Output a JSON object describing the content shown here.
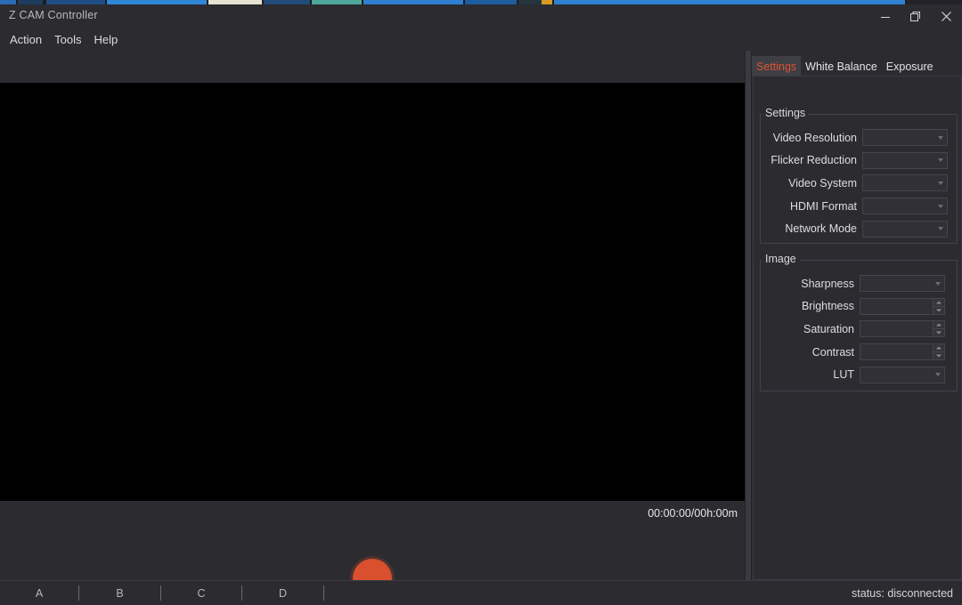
{
  "window": {
    "title": "Z CAM Controller",
    "controls": {
      "minimize": "minimize-icon",
      "maximize": "restore-icon",
      "close": "close-icon"
    }
  },
  "menu": {
    "items": [
      {
        "label": "Action"
      },
      {
        "label": "Tools"
      },
      {
        "label": "Help"
      }
    ]
  },
  "preview": {
    "timecode": "00:00:00/00h:00m",
    "record_button": "record-button",
    "background_color": "#000000"
  },
  "panel": {
    "tabs": [
      {
        "label": "Settings",
        "active": true
      },
      {
        "label": "White Balance",
        "active": false
      },
      {
        "label": "Exposure",
        "active": false
      }
    ],
    "groups": [
      {
        "title": "Settings",
        "fields": [
          {
            "label": "Video Resolution",
            "value": "",
            "control": "combobox"
          },
          {
            "label": "Flicker Reduction",
            "value": "",
            "control": "combobox"
          },
          {
            "label": "Video System",
            "value": "",
            "control": "combobox"
          },
          {
            "label": "HDMI Format",
            "value": "",
            "control": "combobox"
          },
          {
            "label": "Network Mode",
            "value": "",
            "control": "combobox"
          }
        ]
      },
      {
        "title": "Image",
        "fields": [
          {
            "label": "Sharpness",
            "value": "",
            "control": "combobox"
          },
          {
            "label": "Brightness",
            "value": "",
            "control": "spinbox"
          },
          {
            "label": "Saturation",
            "value": "",
            "control": "spinbox"
          },
          {
            "label": "Contrast",
            "value": "",
            "control": "spinbox"
          },
          {
            "label": "LUT",
            "value": "",
            "control": "combobox"
          }
        ]
      }
    ]
  },
  "status_bar": {
    "cells": [
      {
        "label": "A"
      },
      {
        "label": "B"
      },
      {
        "label": "C"
      },
      {
        "label": "D"
      }
    ],
    "status": "status: disconnected"
  },
  "colors": {
    "window_bg": "#2b2b30",
    "panel_bg": "#2b2b30",
    "accent": "#e0542f",
    "record": "#d9502f",
    "text": "#dedee2",
    "border": "#43434a"
  }
}
